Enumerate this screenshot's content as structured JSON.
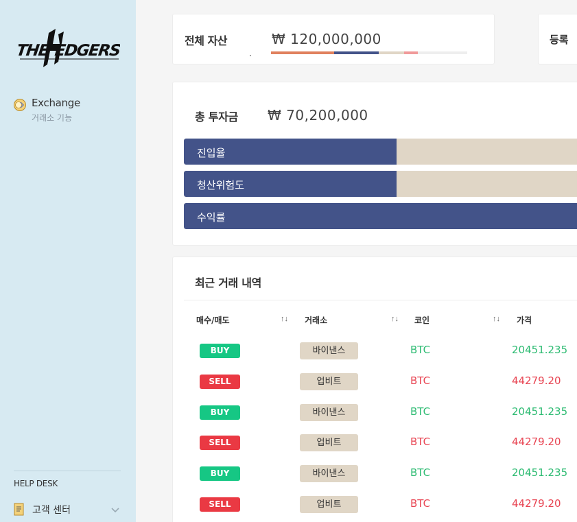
{
  "sidebar": {
    "logo_text": "THE HEDGERS",
    "nav": [
      {
        "title": "Exchange",
        "subtitle": "거래소 기능",
        "icon": "exchange-coin-icon"
      }
    ],
    "help_desk": {
      "title": "HELP DESK",
      "items": [
        {
          "label": "고객 센터",
          "icon": "document-icon"
        }
      ]
    }
  },
  "assets": {
    "label": "전체 자산",
    "value": "₩ 120,000,000",
    "bar_segments": [
      {
        "fraction": 0.32,
        "color": "#e0815e"
      },
      {
        "fraction": 0.23,
        "color": "#435389"
      },
      {
        "fraction": 0.13,
        "color": "#e0d6c6"
      },
      {
        "fraction": 0.07,
        "color": "#f09a9a"
      }
    ]
  },
  "register": {
    "label": "등록"
  },
  "investment": {
    "label": "총 투자금",
    "value": "₩ 70,200,000",
    "metrics": [
      {
        "label": "진입율",
        "fraction": 0.53
      },
      {
        "label": "청산위험도",
        "fraction": 0.53
      },
      {
        "label": "수익률",
        "fraction": 1.0
      }
    ],
    "colors": {
      "fill": "#435389",
      "track": "#e0d6c6"
    }
  },
  "history": {
    "title": "최근 거래 내역",
    "columns": [
      "매수/매도",
      "거래소",
      "코인",
      "가격"
    ],
    "sort_symbol": "↑↓",
    "rows": [
      {
        "side": "BUY",
        "exchange": "바이낸스",
        "coin": "BTC",
        "price": "20451.235"
      },
      {
        "side": "SELL",
        "exchange": "업비트",
        "coin": "BTC",
        "price": "44279.20"
      },
      {
        "side": "BUY",
        "exchange": "바이낸스",
        "coin": "BTC",
        "price": "20451.235"
      },
      {
        "side": "SELL",
        "exchange": "업비트",
        "coin": "BTC",
        "price": "44279.20"
      },
      {
        "side": "BUY",
        "exchange": "바이낸스",
        "coin": "BTC",
        "price": "20451.235"
      },
      {
        "side": "SELL",
        "exchange": "업비트",
        "coin": "BTC",
        "price": "44279.20"
      }
    ],
    "colors": {
      "buy": "#16c784",
      "sell": "#ea3943"
    }
  }
}
